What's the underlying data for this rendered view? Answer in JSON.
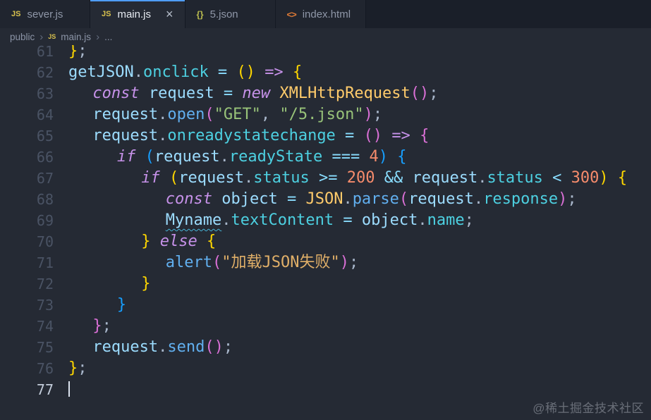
{
  "watermark": "@稀土掘金技术社区",
  "icons": {
    "js": "JS",
    "json": "{}",
    "html": "<>",
    "close": "×",
    "chevron": "›"
  },
  "tabs": [
    {
      "label": "sever.js",
      "icon": "js",
      "active": false,
      "closable": false
    },
    {
      "label": "main.js",
      "icon": "js",
      "active": true,
      "closable": true
    },
    {
      "label": "5.json",
      "icon": "json",
      "active": false,
      "closable": false
    },
    {
      "label": "index.html",
      "icon": "html",
      "active": false,
      "closable": false
    }
  ],
  "breadcrumb": [
    {
      "label": "public"
    },
    {
      "label": "main.js",
      "icon": "js"
    },
    {
      "label": "..."
    }
  ],
  "editor": {
    "active_line": 77,
    "squiggle_color": "#45b3d6",
    "palette": {
      "d": "#d6deeb",
      "kw": "#c792ea",
      "var": "#9cdcfe",
      "prop": "#4dd0e1",
      "fn": "#61afef",
      "cls": "#ffcb6b",
      "str": "#98c379",
      "strcjk": "#e0af68",
      "num": "#f78c6c",
      "op": "#89ddff",
      "pun": "#a9b7cb",
      "b1": "#ffd700",
      "b2": "#da70d6",
      "b3": "#179fff"
    },
    "lines": [
      {
        "n": 61,
        "i": 0,
        "t": [
          [
            "}",
            "b1"
          ],
          [
            ";",
            "pun"
          ]
        ]
      },
      {
        "n": 62,
        "i": 0,
        "t": [
          [
            "getJSON",
            "var"
          ],
          [
            ".",
            "pun"
          ],
          [
            "onclick",
            "prop"
          ],
          [
            " = ",
            "op"
          ],
          [
            "()",
            "b1"
          ],
          [
            " ",
            "d"
          ],
          [
            "=>",
            "kw"
          ],
          [
            " ",
            "d"
          ],
          [
            "{",
            "b1"
          ]
        ]
      },
      {
        "n": 63,
        "i": 1,
        "t": [
          [
            "const ",
            "kw"
          ],
          [
            "request",
            "var"
          ],
          [
            " = ",
            "op"
          ],
          [
            "new ",
            "kw"
          ],
          [
            "XMLHttpRequest",
            "cls"
          ],
          [
            "()",
            "b2"
          ],
          [
            ";",
            "pun"
          ]
        ]
      },
      {
        "n": 64,
        "i": 1,
        "t": [
          [
            "request",
            "var"
          ],
          [
            ".",
            "pun"
          ],
          [
            "open",
            "fn"
          ],
          [
            "(",
            "b2"
          ],
          [
            "\"GET\"",
            "str"
          ],
          [
            ", ",
            "pun"
          ],
          [
            "\"/5.json\"",
            "str"
          ],
          [
            ")",
            "b2"
          ],
          [
            ";",
            "pun"
          ]
        ]
      },
      {
        "n": 65,
        "i": 1,
        "t": [
          [
            "request",
            "var"
          ],
          [
            ".",
            "pun"
          ],
          [
            "onreadystatechange",
            "prop"
          ],
          [
            " = ",
            "op"
          ],
          [
            "()",
            "b2"
          ],
          [
            " ",
            "d"
          ],
          [
            "=>",
            "kw"
          ],
          [
            " ",
            "d"
          ],
          [
            "{",
            "b2"
          ]
        ]
      },
      {
        "n": 66,
        "i": 2,
        "t": [
          [
            "if ",
            "kw"
          ],
          [
            "(",
            "b3"
          ],
          [
            "request",
            "var"
          ],
          [
            ".",
            "pun"
          ],
          [
            "readyState",
            "prop"
          ],
          [
            " === ",
            "op"
          ],
          [
            "4",
            "num"
          ],
          [
            ") ",
            "b3"
          ],
          [
            "{",
            "b3"
          ]
        ]
      },
      {
        "n": 67,
        "i": 3,
        "t": [
          [
            "if ",
            "kw"
          ],
          [
            "(",
            "b1"
          ],
          [
            "request",
            "var"
          ],
          [
            ".",
            "pun"
          ],
          [
            "status",
            "prop"
          ],
          [
            " >= ",
            "op"
          ],
          [
            "200",
            "num"
          ],
          [
            " && ",
            "op"
          ],
          [
            "request",
            "var"
          ],
          [
            ".",
            "pun"
          ],
          [
            "status",
            "prop"
          ],
          [
            " < ",
            "op"
          ],
          [
            "300",
            "num"
          ],
          [
            ") ",
            "b1"
          ],
          [
            "{",
            "b1"
          ]
        ]
      },
      {
        "n": 68,
        "i": 4,
        "t": [
          [
            "const ",
            "kw"
          ],
          [
            "object",
            "var"
          ],
          [
            " = ",
            "op"
          ],
          [
            "JSON",
            "cls"
          ],
          [
            ".",
            "pun"
          ],
          [
            "parse",
            "fn"
          ],
          [
            "(",
            "b2"
          ],
          [
            "request",
            "var"
          ],
          [
            ".",
            "pun"
          ],
          [
            "response",
            "prop"
          ],
          [
            ")",
            "b2"
          ],
          [
            ";",
            "pun"
          ]
        ]
      },
      {
        "n": 69,
        "i": 4,
        "t": [
          [
            "Myname",
            "var",
            "u"
          ],
          [
            ".",
            "pun"
          ],
          [
            "textContent",
            "prop"
          ],
          [
            " = ",
            "op"
          ],
          [
            "object",
            "var"
          ],
          [
            ".",
            "pun"
          ],
          [
            "name",
            "prop"
          ],
          [
            ";",
            "pun"
          ]
        ]
      },
      {
        "n": 70,
        "i": 3,
        "t": [
          [
            "}",
            "b1"
          ],
          [
            " else ",
            "kw"
          ],
          [
            "{",
            "b1"
          ]
        ]
      },
      {
        "n": 71,
        "i": 4,
        "t": [
          [
            "alert",
            "fn"
          ],
          [
            "(",
            "b2"
          ],
          [
            "\"加载JSON失败\"",
            "strcjk"
          ],
          [
            ")",
            "b2"
          ],
          [
            ";",
            "pun"
          ]
        ]
      },
      {
        "n": 72,
        "i": 3,
        "t": [
          [
            "}",
            "b1"
          ]
        ]
      },
      {
        "n": 73,
        "i": 2,
        "t": [
          [
            "}",
            "b3"
          ]
        ]
      },
      {
        "n": 74,
        "i": 1,
        "t": [
          [
            "}",
            "b2"
          ],
          [
            ";",
            "pun"
          ]
        ]
      },
      {
        "n": 75,
        "i": 1,
        "t": [
          [
            "request",
            "var"
          ],
          [
            ".",
            "pun"
          ],
          [
            "send",
            "fn"
          ],
          [
            "()",
            "b2"
          ],
          [
            ";",
            "pun"
          ]
        ]
      },
      {
        "n": 76,
        "i": 0,
        "t": [
          [
            "}",
            "b1"
          ],
          [
            ";",
            "pun"
          ]
        ]
      },
      {
        "n": 77,
        "i": 0,
        "t": [],
        "caret": true
      }
    ]
  },
  "ui_colors": {
    "editor_bg": "#252a34",
    "tabbar_bg": "#1a1f29",
    "tab_bg": "#20252f",
    "active_tab_accent": "#4f9df8"
  }
}
